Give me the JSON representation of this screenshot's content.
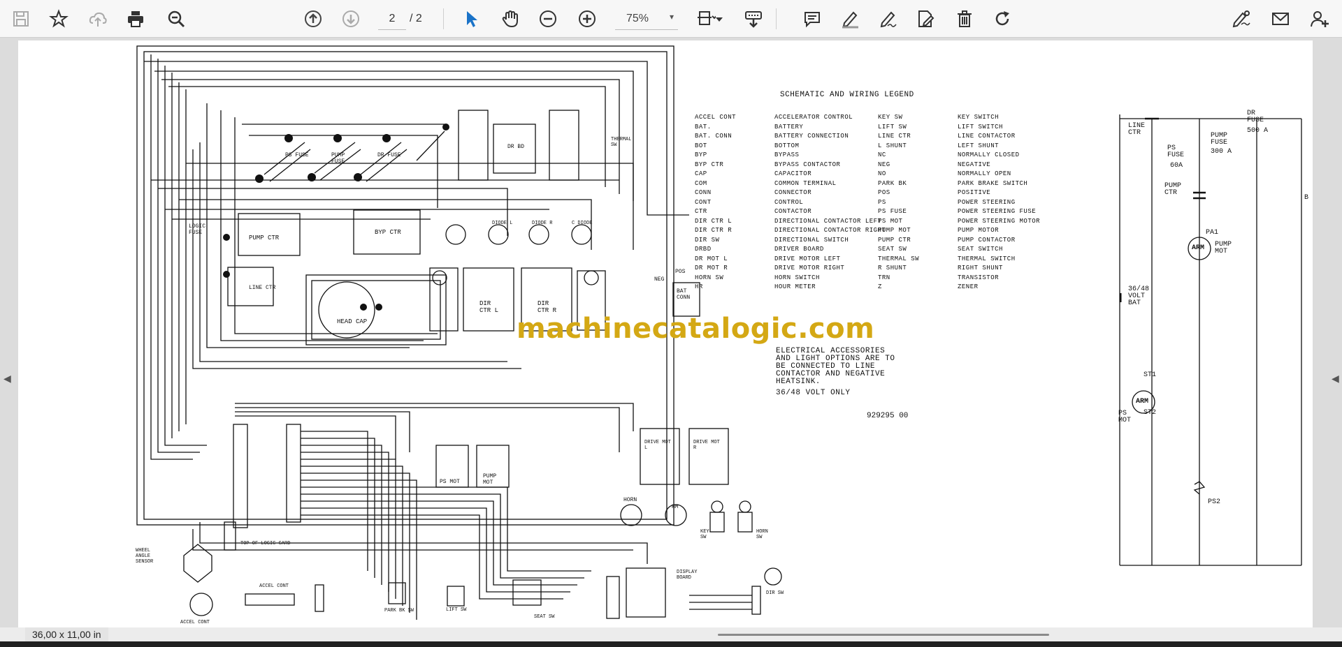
{
  "toolbar": {
    "page_current": "2",
    "page_total": "/ 2",
    "zoom_value": "75%",
    "zoom_caret": "▾"
  },
  "status": {
    "page_size": "36,00 x 11,00 in"
  },
  "document": {
    "legend_title": "SCHEMATIC AND WIRING LEGEND",
    "legend_col1": [
      "ACCEL CONT",
      "BAT.",
      "BAT. CONN",
      "BOT",
      "BYP",
      "BYP CTR",
      "CAP",
      "COM",
      "CONN",
      "CONT",
      "CTR",
      "DIR CTR L",
      "DIR CTR R",
      "DIR SW",
      "DRBD",
      "DR MOT L",
      "DR MOT R",
      "HORN SW",
      "HR"
    ],
    "legend_col2": [
      "ACCELERATOR CONTROL",
      "BATTERY",
      "BATTERY CONNECTION",
      "BOTTOM",
      "BYPASS",
      "BYPASS CONTACTOR",
      "CAPACITOR",
      "COMMON TERMINAL",
      "CONNECTOR",
      "CONTROL",
      "CONTACTOR",
      "DIRECTIONAL CONTACTOR LEFT",
      "DIRECTIONAL CONTACTOR RIGHT",
      "DIRECTIONAL SWITCH",
      "DRIVER BOARD",
      "DRIVE MOTOR LEFT",
      "DRIVE MOTOR RIGHT",
      "HORN SWITCH",
      "HOUR METER"
    ],
    "legend_col3": [
      "KEY SW",
      "LIFT SW",
      "LINE CTR",
      "L SHUNT",
      "NC",
      "NEG",
      "NO",
      "PARK BK",
      "POS",
      "PS",
      "PS FUSE",
      "PS MOT",
      "PUMP MOT",
      "PUMP CTR",
      "SEAT SW",
      "THERMAL SW",
      "R SHUNT",
      "TRN",
      "Z"
    ],
    "legend_col4": [
      "KEY SWITCH",
      "LIFT SWITCH",
      "LINE CONTACTOR",
      "LEFT SHUNT",
      "NORMALLY CLOSED",
      "NEGATIVE",
      "NORMALLY OPEN",
      "PARK BRAKE SWITCH",
      "POSITIVE",
      "POWER STEERING",
      "POWER STEERING FUSE",
      "POWER STEERING MOTOR",
      "PUMP MOTOR",
      "PUMP CONTACTOR",
      "SEAT SWITCH",
      "THERMAL SWITCH",
      "RIGHT SHUNT",
      "TRANSISTOR",
      "ZENER"
    ],
    "note_lines": [
      "ELECTRICAL ACCESSORIES",
      "AND LIGHT OPTIONS ARE TO",
      "BE CONNECTED TO LINE",
      "CONTACTOR AND NEGATIVE",
      "HEATSINK."
    ],
    "volt_note": "36/48 VOLT ONLY",
    "part_number": "929295 00",
    "watermark": "machinecatalogic.com",
    "labels": {
      "logic_fuse": "LOGIC FUSE",
      "pump_ctr": "PUMP CTR",
      "byp_ctr": "BYP CTR",
      "line_ctr": "LINE CTR",
      "head_cap": "HEAD CAP",
      "dir_ctr_l": "DIR CTR L",
      "dir_ctr_r": "DIR CTR R",
      "bat_conn": "BAT CONN",
      "drbd": "DR BD",
      "thermal_sw": "THERMAL SW",
      "ps_fuse": "PS FUSE",
      "pump_fuse": "PUMP FUSE",
      "dr_fuse": "DR FUSE",
      "diode_l": "DIODE L",
      "diode_r": "DIODE R",
      "c_diode": "C DIODE",
      "ps_mot": "PS MOT",
      "pump_mot": "PUMP MOT",
      "drive_mot_l": "DRIVE MOT L",
      "drive_mot_r": "DRIVE MOT R",
      "horn": "HORN",
      "hm": "HM",
      "key_sw": "KEY SW",
      "horn_sw": "HORN SW",
      "wheel_angle_sensor": "WHEEL ANGLE SENSOR",
      "top_of_logic_card": "TOP OF LOGIC CARD",
      "accel_cont": "ACCEL CONT",
      "accel_cont_bottom": "ACCEL CONT",
      "park_bk_sw": "PARK BK SW",
      "lift_sw": "LIFT SW",
      "seat_sw": "SEAT SW",
      "display_board": "DISPLAY BOARD",
      "dir_sw": "DIR SW",
      "pos": "POS",
      "neg": "NEG"
    },
    "schematic": {
      "line_ctr": "LINE CTR",
      "dr_fuse": "DR FUSE",
      "dr_fuse_val": "500 A",
      "ps_fuse": "PS FUSE",
      "ps_fuse_val": "60A",
      "pump_fuse": "PUMP FUSE",
      "pump_fuse_val": "300 A",
      "pump_ctr": "PUMP CTR",
      "pa1": "PA1",
      "arm": "ARM",
      "pump_mot": "PUMP MOT",
      "bat": "36/48 VOLT BAT",
      "st1": "ST1",
      "st2": "ST2",
      "arm2": "ARM",
      "ps_mot": "PS MOT",
      "ps2": "PS2",
      "b": "B"
    }
  }
}
